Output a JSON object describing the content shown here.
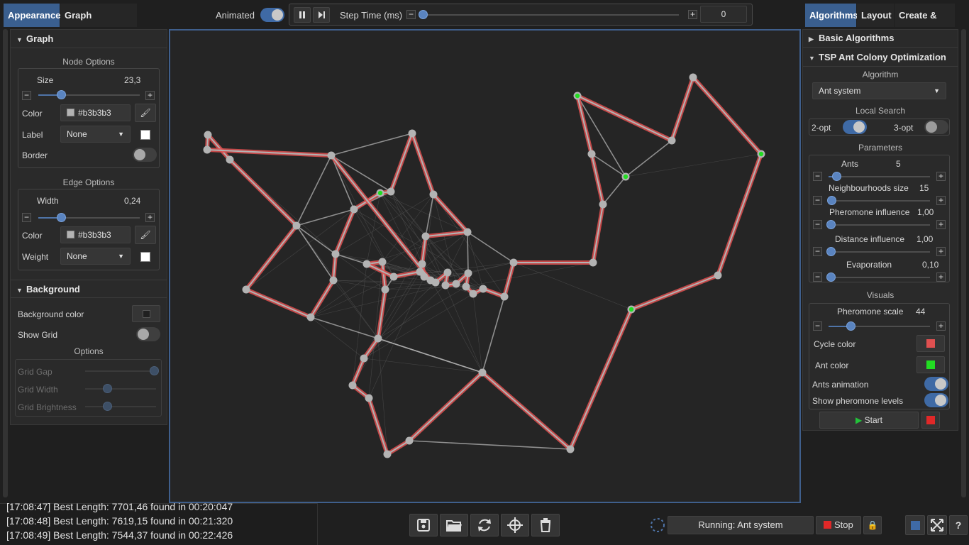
{
  "left_tabs": [
    "Appearance",
    "Graph Properties"
  ],
  "right_tabs": [
    "Algorithms",
    "Layout",
    "Create & Edit"
  ],
  "top": {
    "animated_label": "Animated",
    "step_time_label": "Step Time (ms)",
    "step_time_value": "0"
  },
  "graph_section": {
    "title": "Graph",
    "node_options_title": "Node Options",
    "size_label": "Size",
    "size_value": "23,3",
    "color_label": "Color",
    "node_color": "#b3b3b3",
    "label_label": "Label",
    "label_value": "None",
    "border_label": "Border",
    "edge_options_title": "Edge Options",
    "width_label": "Width",
    "width_value": "0,24",
    "edge_color_label": "Color",
    "edge_color": "#b3b3b3",
    "weight_label": "Weight",
    "weight_value": "None"
  },
  "background_section": {
    "title": "Background",
    "bg_color_label": "Background color",
    "show_grid_label": "Show Grid",
    "options_title": "Options",
    "grid_gap_label": "Grid Gap",
    "grid_width_label": "Grid Width",
    "grid_brightness_label": "Grid Brightness"
  },
  "algorithms": {
    "basic_title": "Basic Algorithms",
    "tsp_title": "TSP Ant Colony Optimization",
    "algorithm_label": "Algorithm",
    "algorithm_value": "Ant system",
    "local_search_label": "Local Search",
    "two_opt_label": "2-opt",
    "three_opt_label": "3-opt",
    "parameters_label": "Parameters",
    "params": [
      {
        "label": "Ants",
        "value": "5",
        "level": 0.08
      },
      {
        "label": "Neighbourhoods size",
        "value": "15",
        "level": 0.03
      },
      {
        "label": "Pheromone influence",
        "value": "1,00",
        "level": 0.02
      },
      {
        "label": "Distance influence",
        "value": "1,00",
        "level": 0.02
      },
      {
        "label": "Evaporation",
        "value": "0,10",
        "level": 0.02
      }
    ],
    "visuals_label": "Visuals",
    "pheromone_scale_label": "Pheromone scale",
    "pheromone_scale_value": "44",
    "cycle_color_label": "Cycle color",
    "cycle_color": "#e05050",
    "ant_color_label": "Ant color",
    "ant_color": "#22dd22",
    "ants_animation_label": "Ants animation",
    "show_pheromone_label": "Show pheromone levels",
    "start_label": "Start"
  },
  "log": [
    "[17:08:47] Best Length: 7701,46 found in 00:20:047",
    "[17:08:48] Best Length: 7619,15 found in 00:21:320",
    "[17:08:49] Best Length: 7544,37 found in 00:22:426"
  ],
  "status": {
    "running_text": "Running: Ant system",
    "stop_label": "Stop"
  },
  "icons": {
    "save": "save-icon",
    "open": "folder-open-icon",
    "refresh": "refresh-icon",
    "center": "crosshair-icon",
    "delete": "trash-icon"
  }
}
